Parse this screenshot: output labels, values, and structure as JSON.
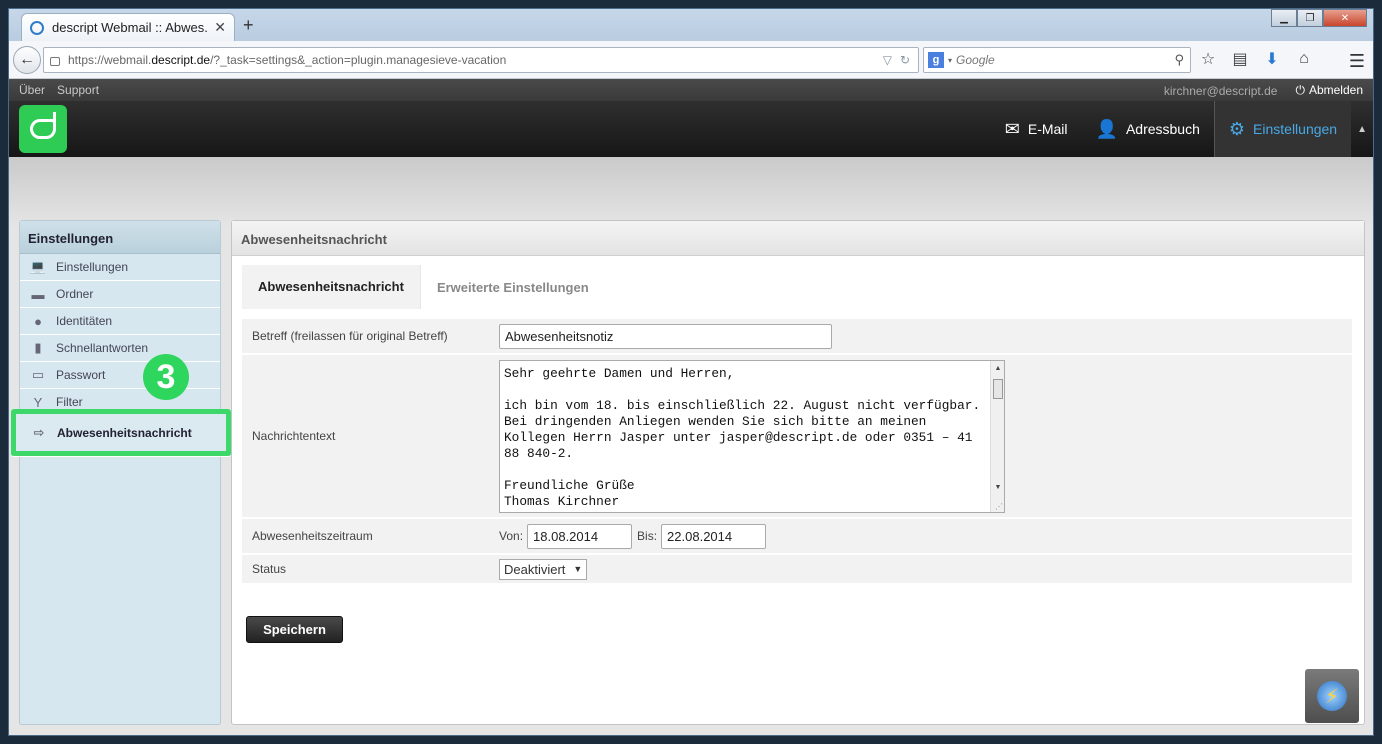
{
  "browser": {
    "tab_title": "descript Webmail :: Abwes...",
    "tab_close": "✕",
    "new_tab": "+",
    "url_prefix": "https://webmail.",
    "url_domain": "descript.de",
    "url_rest": "/?_task=settings&_action=plugin.managesieve-vacation",
    "search_engine": "Google",
    "search_placeholder": "Google"
  },
  "topbar": {
    "links": [
      "Über",
      "Support"
    ],
    "user": "kirchner@descript.de",
    "logout": "Abmelden"
  },
  "appnav": [
    {
      "label": "E-Mail",
      "icon": "mail-icon"
    },
    {
      "label": "Adressbuch",
      "icon": "person-icon"
    },
    {
      "label": "Einstellungen",
      "icon": "gear-icon",
      "active": true
    }
  ],
  "sidebar": {
    "title": "Einstellungen",
    "items": [
      {
        "label": "Einstellungen",
        "icon": "laptop-icon"
      },
      {
        "label": "Ordner",
        "icon": "folder-icon"
      },
      {
        "label": "Identitäten",
        "icon": "person-icon"
      },
      {
        "label": "Schnellantworten",
        "icon": "document-icon"
      },
      {
        "label": "Passwort",
        "icon": "password-icon"
      },
      {
        "label": "Filter",
        "icon": "filter-icon"
      },
      {
        "label": "Abwesenheitsnachricht",
        "icon": "out-of-office-icon",
        "selected": true
      }
    ],
    "badge": "3"
  },
  "content": {
    "title": "Abwesenheitsnachricht",
    "tabs": [
      "Abwesenheitsnachricht",
      "Erweiterte Einstellungen"
    ],
    "subject_label": "Betreff (freilassen für original Betreff)",
    "subject_value": "Abwesenheitsnotiz",
    "message_label": "Nachrichtentext",
    "message_value": "Sehr geehrte Damen und Herren,\n\nich bin vom 18. bis einschließlich 22. August nicht verfügbar. Bei dringenden Anliegen wenden Sie sich bitte an meinen Kollegen Herrn Jasper unter jasper@descript.de oder 0351 – 41 88 840-2.\n\nFreundliche Grüße\nThomas Kirchner",
    "period_label": "Abwesenheitszeitraum",
    "from_label": "Von:",
    "from_value": "18.08.2014",
    "to_label": "Bis:",
    "to_value": "22.08.2014",
    "status_label": "Status",
    "status_value": "Deaktiviert",
    "save_label": "Speichern"
  },
  "colors": {
    "accent": "#48a9e6",
    "highlight_green": "#3ed86a",
    "logo_green": "#2ecc55"
  }
}
